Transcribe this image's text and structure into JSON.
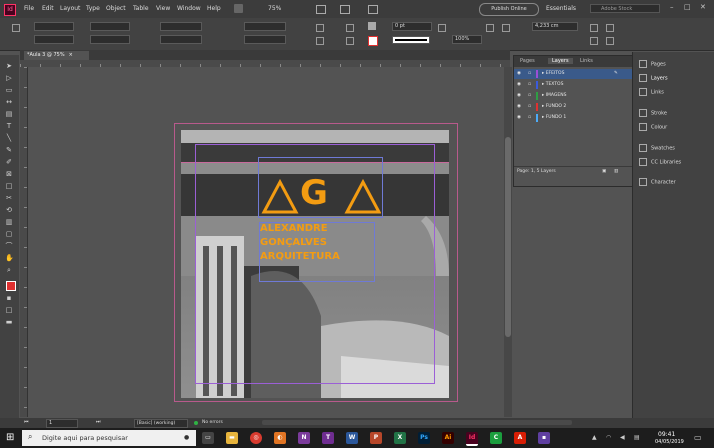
{
  "menubar": {
    "app_logo": "Id",
    "items": [
      "File",
      "Edit",
      "Layout",
      "Type",
      "Object",
      "Table",
      "View",
      "Window",
      "Help"
    ],
    "zoom": "75%",
    "publish_button": "Publish Online",
    "workspace": "Essentials",
    "search_placeholder": "Adobe Stock"
  },
  "controlbar": {
    "stroke_weight": "0 pt",
    "opacity": "100%",
    "frame_width": "4,233 cm"
  },
  "document_tab": {
    "title": "*Aula 3 @ 75%"
  },
  "artwork": {
    "logo_text": "G",
    "name_lines": [
      "ALEXANDRE",
      "GONÇALVES",
      "ARQUITETURA"
    ],
    "colors": {
      "accent": "#f39c12"
    }
  },
  "layers_panel": {
    "tabs": [
      "Pages",
      "Layers",
      "Links"
    ],
    "layers": [
      {
        "name": "EFEITOS",
        "color": "#9b4fd6",
        "selected": true
      },
      {
        "name": "TEXTOS",
        "color": "#3b5bdb",
        "selected": false
      },
      {
        "name": "IMAGENS",
        "color": "#2f9e44",
        "selected": false
      },
      {
        "name": "FUNDO 2",
        "color": "#e03131",
        "selected": false
      },
      {
        "name": "FUNDO 1",
        "color": "#4dabf7",
        "selected": false
      }
    ],
    "footer": "Page: 1, 5 Layers"
  },
  "panel_dock": {
    "items": [
      "Pages",
      "Layers",
      "Links",
      "Stroke",
      "Colour",
      "Swatches",
      "CC Libraries",
      "Character"
    ]
  },
  "statusbar": {
    "page_number": "1",
    "master": "[Basic] (working)",
    "errors": "No errors"
  },
  "taskbar": {
    "search_placeholder": "Digite aqui para pesquisar",
    "time": "09:41",
    "date": "04/05/2019"
  }
}
